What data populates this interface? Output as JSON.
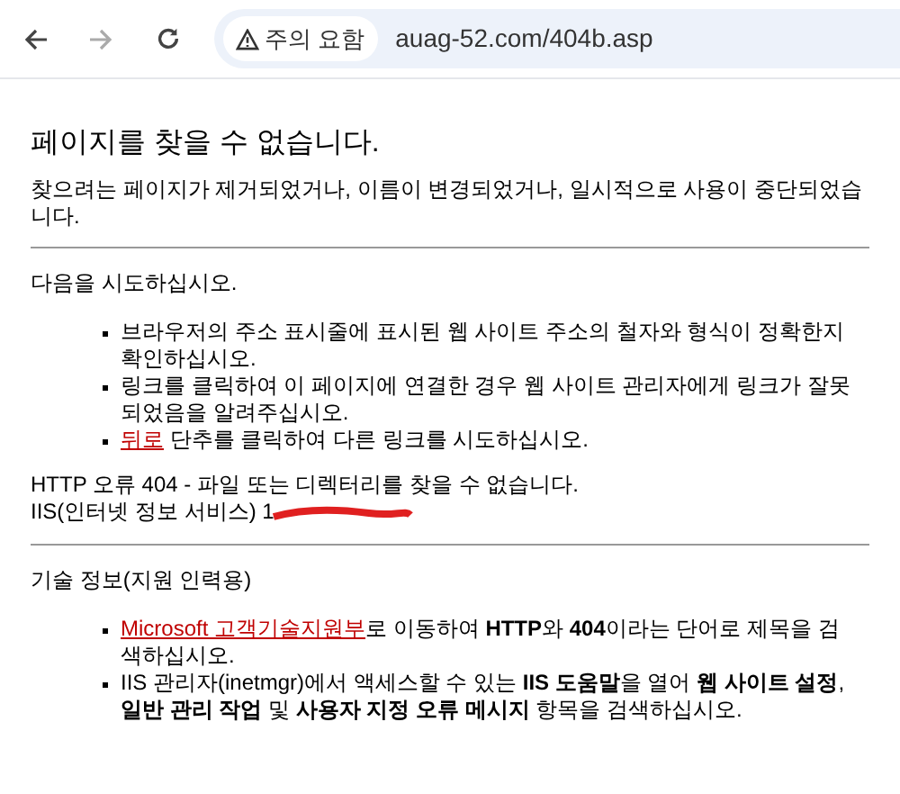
{
  "browser": {
    "security_chip": "주의 요함",
    "url": "auag-52.com/404b.asp"
  },
  "page": {
    "heading": "페이지를 찾을 수 없습니다.",
    "intro": "찾으려는 페이지가 제거되었거나, 이름이 변경되었거나, 일시적으로 사용이 중단되었습니다.",
    "try_heading": "다음을 시도하십시오.",
    "try_items": [
      {
        "parts": [
          {
            "kind": "text",
            "text": "브라우저의 주소 표시줄에 표시된 웹 사이트 주소의 철자와 형식이 정확한지 확인하십시오."
          }
        ]
      },
      {
        "parts": [
          {
            "kind": "text",
            "text": "링크를 클릭하여 이 페이지에 연결한 경우 웹 사이트 관리자에게 링크가 잘못되었음을 알려주십시오."
          }
        ]
      },
      {
        "parts": [
          {
            "kind": "link",
            "text": "뒤로"
          },
          {
            "kind": "text",
            "text": " 단추를 클릭하여 다른 링크를 시도하십시오."
          }
        ]
      }
    ],
    "error_line": "HTTP 오류 404 - 파일 또는 디렉터리를 찾을 수 없습니다.",
    "server_line": "IIS(인터넷 정보 서비스) 1",
    "server_line_redacted": true,
    "tech_heading": "기술 정보(지원 인력용)",
    "tech_items": [
      {
        "parts": [
          {
            "kind": "link",
            "text": "Microsoft 고객기술지원부"
          },
          {
            "kind": "text",
            "text": "로 이동하여 **HTTP**와 **404**이라는 단어로 제목을 검색하십시오."
          }
        ]
      },
      {
        "parts": [
          {
            "kind": "text",
            "text": "IIS 관리자(inetmgr)에서 액세스할 수 있는 **IIS 도움말**을 열어 **웹 사이트 설정**, **일반 관리 작업** 및 **사용자 지정 오류 메시지** 항목을 검색하십시오."
          }
        ]
      }
    ]
  }
}
